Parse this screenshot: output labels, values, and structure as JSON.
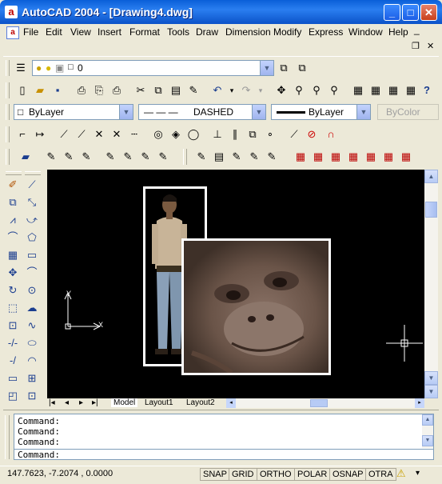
{
  "window": {
    "title": "AutoCAD 2004 - [Drawing4.dwg]",
    "app_icon": "a",
    "minimize": "_",
    "maximize": "□",
    "close": "✕"
  },
  "menubar": {
    "items": [
      "File",
      "Edit",
      "View",
      "Insert",
      "Format",
      "Tools",
      "Draw",
      "Dimension",
      "Modify",
      "Express",
      "Window",
      "Help"
    ],
    "doc_min": "_",
    "doc_restore": "❐",
    "doc_close": "✕"
  },
  "layer_toolbar": {
    "layer_value": "0"
  },
  "properties_toolbar": {
    "color": "ByLayer",
    "linetype_sample": "— — —",
    "linetype": "DASHED",
    "lineweight": "ByLayer",
    "plotstyle": "ByColor"
  },
  "canvas": {
    "ucs_x": "X",
    "ucs_y": "Y",
    "background": "#000000"
  },
  "layout_tabs": [
    "Model",
    "Layout1",
    "Layout2"
  ],
  "command": {
    "lines": [
      "Command:",
      "Command:",
      "Command:"
    ],
    "prompt": "Command:"
  },
  "status": {
    "coords": "147.7623, -7.2074 , 0.0000",
    "toggles": [
      "SNAP",
      "GRID",
      "ORTHO",
      "POLAR",
      "OSNAP",
      "OTRA"
    ]
  }
}
